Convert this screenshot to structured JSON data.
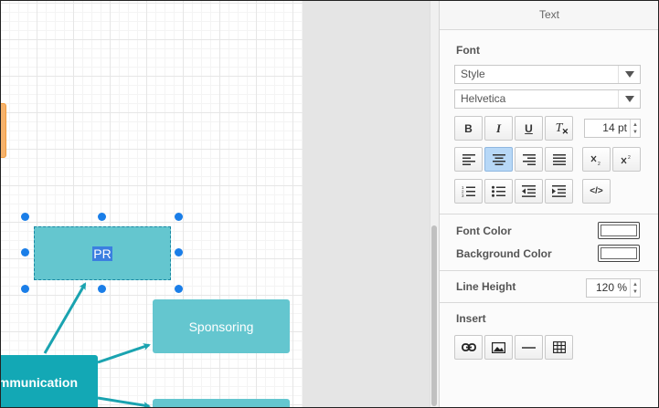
{
  "canvas": {
    "nodes": {
      "pr": "PR",
      "sponsoring": "Sponsoring",
      "communication": "Communication",
      "bottom": ""
    },
    "colors": {
      "node_fill": "#64c6cf",
      "node_dark": "#13a8b5",
      "selection": "#1a7ee8",
      "orange": "#f6b26b"
    }
  },
  "panel": {
    "title": "Text",
    "font_section": "Font",
    "style_select": "Style",
    "font_family_select": "Helvetica",
    "font_size": "14 pt",
    "buttons": {
      "bold": "B",
      "italic": "I",
      "underline": "U",
      "clear_format": "T",
      "align_left": "align-left-icon",
      "align_center": "align-center-icon",
      "align_right": "align-right-icon",
      "justify": "justify-icon",
      "subscript": "subscript-icon",
      "superscript": "superscript-icon",
      "numbered_list": "numbered-list-icon",
      "bullet_list": "bullet-list-icon",
      "outdent": "outdent-icon",
      "indent": "indent-icon",
      "html": "</>"
    },
    "font_color_label": "Font Color",
    "background_color_label": "Background Color",
    "line_height_label": "Line Height",
    "line_height_value": "120 %",
    "insert_section": "Insert",
    "insert_icons": [
      "link-icon",
      "image-icon",
      "horizontal-rule-icon",
      "table-icon"
    ]
  }
}
